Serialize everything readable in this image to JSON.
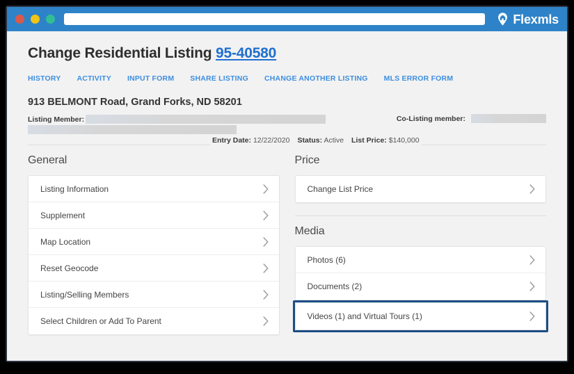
{
  "window": {
    "traffic_lights": [
      "close-red",
      "minimize-yellow",
      "maximize-green"
    ],
    "url_value": "",
    "url_placeholder": "",
    "brand_name": "Flexmls",
    "brand_icon": "home-pin-icon",
    "titlebar_color": "#2e83c8"
  },
  "header": {
    "title_prefix": "Change Residential Listing",
    "listing_number": "95-40580",
    "listing_number_color": "#1f6fd0"
  },
  "nav": {
    "links": [
      {
        "label": "HISTORY"
      },
      {
        "label": "ACTIVITY"
      },
      {
        "label": "INPUT FORM"
      },
      {
        "label": "SHARE LISTING"
      },
      {
        "label": "CHANGE ANOTHER LISTING"
      },
      {
        "label": "MLS ERROR FORM"
      }
    ],
    "link_color": "#3d8ee0"
  },
  "listing": {
    "address": "913 BELMONT Road, Grand Forks, ND 58201",
    "listing_member_label": "Listing Member:",
    "listing_member_value": "",
    "colisting_member_label": "Co-Listing member:",
    "colisting_member_value": "",
    "entry_date_label": "Entry Date:",
    "entry_date_value": "12/22/2020",
    "status_label": "Status:",
    "status_value": "Active",
    "list_price_label": "List Price:",
    "list_price_value": "$140,000"
  },
  "sections": {
    "general": {
      "title": "General",
      "items": [
        {
          "label": "Listing Information"
        },
        {
          "label": "Supplement"
        },
        {
          "label": "Map Location"
        },
        {
          "label": "Reset Geocode"
        },
        {
          "label": "Listing/Selling Members"
        },
        {
          "label": "Select Children or Add To Parent"
        }
      ]
    },
    "price": {
      "title": "Price",
      "items": [
        {
          "label": "Change List Price"
        }
      ]
    },
    "media": {
      "title": "Media",
      "items": [
        {
          "label": "Photos (6)"
        },
        {
          "label": "Documents (2)"
        }
      ],
      "highlighted_item": {
        "label": "Videos (1) and Virtual Tours (1)"
      },
      "highlight_color": "#1c4d86"
    }
  }
}
